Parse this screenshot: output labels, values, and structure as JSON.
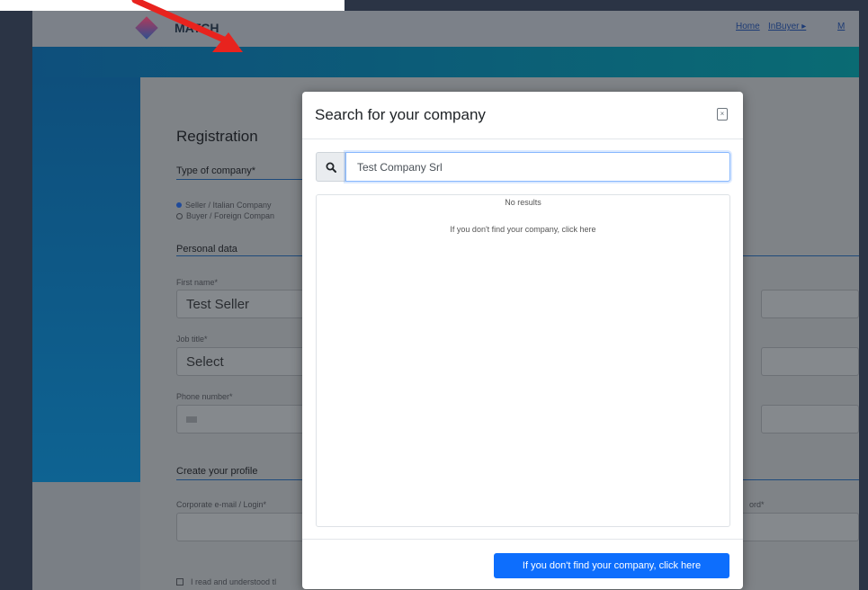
{
  "header": {
    "logo_text": "MATCH",
    "nav": [
      "Home",
      "InBuyer ▸",
      "M"
    ]
  },
  "form": {
    "title": "Registration",
    "type_label": "Type of company*",
    "type_options": [
      "Seller / Italian Company",
      "Buyer / Foreign Compan"
    ],
    "personal_section": "Personal data",
    "first_name_label": "First name*",
    "first_name_value": "Test Seller",
    "job_title_label": "Job title*",
    "job_title_value": "Select",
    "phone_label": "Phone number*",
    "profile_section": "Create your profile",
    "email_label": "Corporate e-mail / Login*",
    "password_label_partial": "ord*",
    "terms_text": "I read and understood tl"
  },
  "modal": {
    "title": "Search for your company",
    "close_label": "×",
    "search_value": "Test Company Srl",
    "no_results": "No results",
    "not_found_link": "If you don't find your company, click here",
    "footer_button": "If you don't find your company, click here"
  },
  "colors": {
    "accent": "#0d6efd",
    "arrow": "#e8231e"
  }
}
